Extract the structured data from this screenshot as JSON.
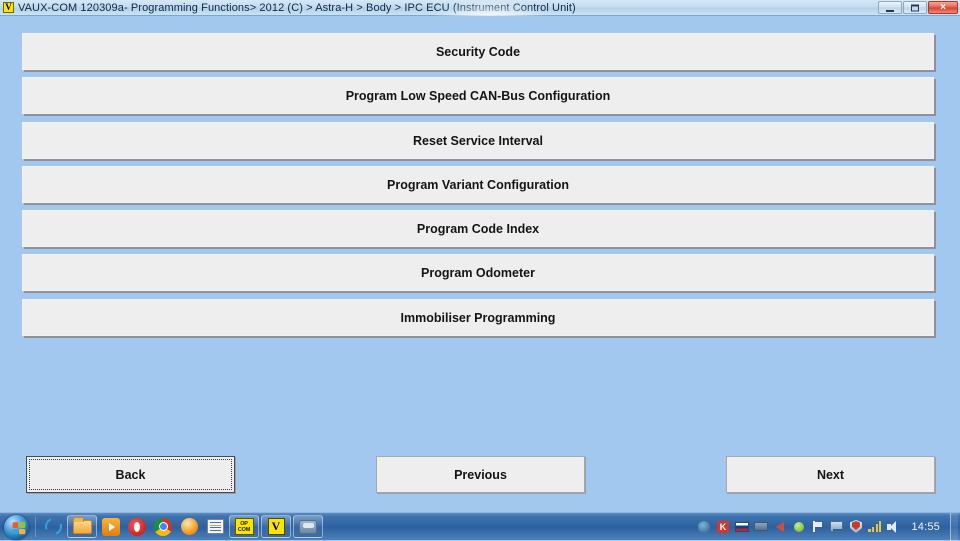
{
  "window": {
    "icon": "vauxcom-v-icon",
    "title": "VAUX-COM 120309a- Programming Functions> 2012 (C) > Astra-H > Body > IPC ECU (Instrument Control Unit)",
    "controls": {
      "minimize": "minimize-icon",
      "maximize": "maximize-icon",
      "close": "×"
    }
  },
  "theme": {
    "background": "#a3c8ef",
    "button_face": "#efeeee",
    "text": "#141414",
    "taskbar": "#2f63a2"
  },
  "menu": {
    "items": [
      {
        "label": "Security Code"
      },
      {
        "label": "Program Low Speed CAN-Bus Configuration"
      },
      {
        "label": "Reset Service Interval"
      },
      {
        "label": "Program Variant Configuration"
      },
      {
        "label": "Program Code Index"
      },
      {
        "label": "Program Odometer"
      },
      {
        "label": "Immobiliser Programming"
      }
    ]
  },
  "navigation": {
    "back": "Back",
    "previous": "Previous",
    "next": "Next",
    "focused": "Back"
  },
  "taskbar": {
    "start": "start-orb-icon",
    "quicklaunch": [
      {
        "name": "internet-explorer-icon"
      },
      {
        "name": "file-explorer-icon"
      },
      {
        "name": "media-player-icon"
      },
      {
        "name": "opera-browser-icon"
      },
      {
        "name": "chrome-browser-icon"
      },
      {
        "name": "orange-ball-icon"
      },
      {
        "name": "list-document-icon"
      }
    ],
    "windows": [
      {
        "name": "opcom-app-icon",
        "label": "OP COM"
      },
      {
        "name": "vauxcom-app-icon",
        "label": "V"
      },
      {
        "name": "car-diagnostics-app-icon"
      }
    ],
    "tray": [
      {
        "name": "opera-tray-icon"
      },
      {
        "name": "kaspersky-tray-icon"
      },
      {
        "name": "russian-keyboard-layout-icon"
      },
      {
        "name": "usb-device-tray-icon"
      },
      {
        "name": "sound-muted-tray-icon"
      },
      {
        "name": "green-status-tray-icon"
      },
      {
        "name": "action-center-flag-icon"
      },
      {
        "name": "network-tray-icon"
      },
      {
        "name": "security-shield-tray-icon"
      },
      {
        "name": "signal-strength-tray-icon"
      },
      {
        "name": "volume-tray-icon"
      }
    ],
    "clock": "14:55"
  }
}
